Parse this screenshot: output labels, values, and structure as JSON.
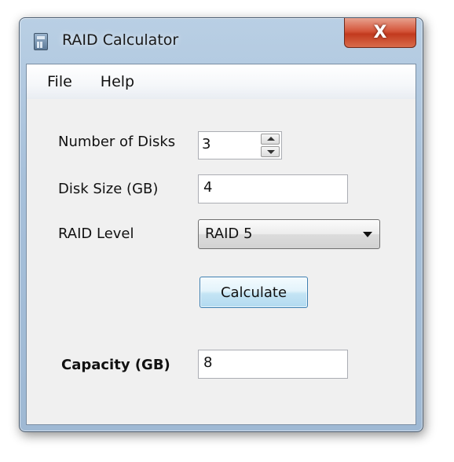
{
  "window": {
    "title": "RAID Calculator",
    "close_glyph": "X"
  },
  "menu": {
    "file": "File",
    "help": "Help"
  },
  "form": {
    "disks_label": "Number of Disks",
    "disks_value": "3",
    "size_label": "Disk Size (GB)",
    "size_value": "4",
    "level_label": "RAID Level",
    "level_value": "RAID 5",
    "calculate_label": "Calculate",
    "capacity_label": "Capacity (GB)",
    "capacity_value": "8"
  },
  "icons": {
    "app": "calculator-icon",
    "close": "close-icon",
    "spin_up": "chevron-up-icon",
    "spin_down": "chevron-down-icon",
    "dropdown": "chevron-down-icon"
  },
  "colors": {
    "client_bg": "#f0f0f0",
    "close_red": "#c23a1e",
    "button_border": "#3c7fb1"
  }
}
